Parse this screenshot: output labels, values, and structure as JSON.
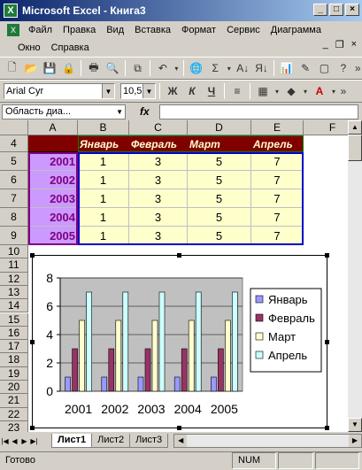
{
  "window": {
    "title": "Microsoft Excel - Книга3",
    "app_icon": "excel-icon"
  },
  "menu": {
    "items": [
      "Файл",
      "Правка",
      "Вид",
      "Вставка",
      "Формат",
      "Сервис",
      "Диаграмма",
      "Окно",
      "Справка"
    ]
  },
  "toolbar": {
    "font_name": "Arial Cyr",
    "font_size": "10,5",
    "bold": "Ж",
    "italic": "К",
    "underline": "Ч"
  },
  "formula_bar": {
    "name_box": "Область диа...",
    "fx_label": "fx",
    "value": ""
  },
  "columns": [
    "A",
    "B",
    "C",
    "D",
    "E",
    "F"
  ],
  "rows": [
    "4",
    "5",
    "6",
    "7",
    "8",
    "9",
    "10",
    "11",
    "12",
    "13",
    "14",
    "15",
    "16",
    "17",
    "18",
    "19",
    "20",
    "21",
    "22",
    "23"
  ],
  "table": {
    "headers": [
      "Январь",
      "Февраль",
      "Март",
      "Апрель"
    ],
    "years": [
      "2001",
      "2002",
      "2003",
      "2004",
      "2005"
    ],
    "values": [
      [
        1,
        3,
        5,
        7
      ],
      [
        1,
        3,
        5,
        7
      ],
      [
        1,
        3,
        5,
        7
      ],
      [
        1,
        3,
        5,
        7
      ],
      [
        1,
        3,
        5,
        7
      ]
    ]
  },
  "chart_data": {
    "type": "bar",
    "categories": [
      "2001",
      "2002",
      "2003",
      "2004",
      "2005"
    ],
    "series": [
      {
        "name": "Январь",
        "values": [
          1,
          1,
          1,
          1,
          1
        ],
        "color": "#9999ff"
      },
      {
        "name": "Февраль",
        "values": [
          3,
          3,
          3,
          3,
          3
        ],
        "color": "#993366"
      },
      {
        "name": "Март",
        "values": [
          5,
          5,
          5,
          5,
          5
        ],
        "color": "#ffffcc"
      },
      {
        "name": "Апрель",
        "values": [
          7,
          7,
          7,
          7,
          7
        ],
        "color": "#ccffff"
      }
    ],
    "yticks": [
      "0",
      "2",
      "4",
      "6",
      "8"
    ],
    "ylim": [
      0,
      8
    ],
    "grid": true,
    "legend": "right",
    "plot_background": "#c0c0c0"
  },
  "sheets": [
    "Лист1",
    "Лист2",
    "Лист3"
  ],
  "active_sheet": "Лист1",
  "status": {
    "ready": "Готово",
    "num": "NUM"
  },
  "colors": {
    "header_row_fill": "#800000",
    "header_row_text": "#ffffcc",
    "data_fill": "#ffffcc",
    "year_fill": "#cc99ff",
    "year_text": "#800080"
  }
}
